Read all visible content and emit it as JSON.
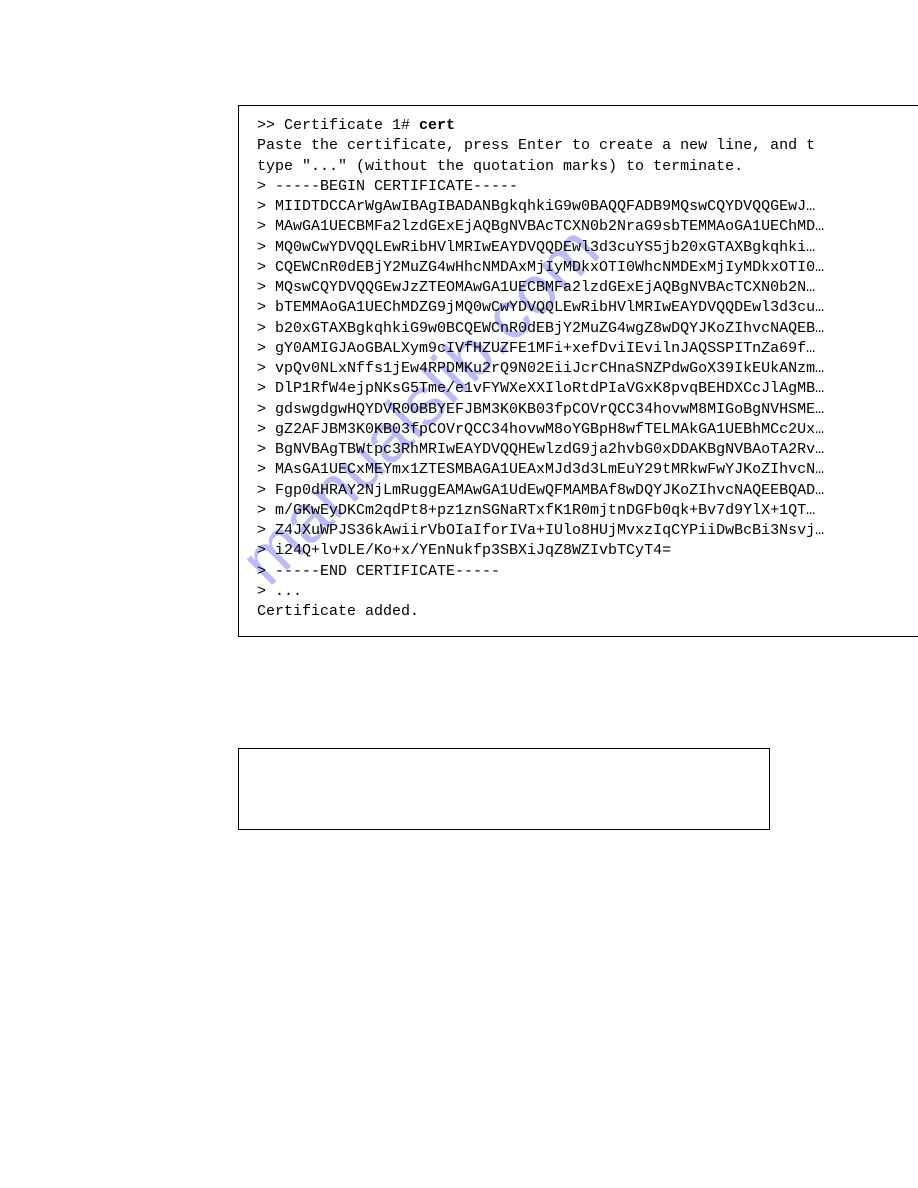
{
  "watermark": "manualslib.com",
  "terminal_output": {
    "prompt_label": ">> Certificate 1# ",
    "command": "cert",
    "instruction_line1": "Paste the certificate, press Enter to create a new line, and t",
    "instruction_line2": "type \"...\" (without the quotation marks) to terminate.",
    "cert_lines": [
      "> -----BEGIN CERTIFICATE-----",
      "> MIIDTDCCArWgAwIBAgIBADANBgkqhkiG9w0BAQQFADB9MQswCQYDVQQGEwJ…",
      "> MAwGA1UECBMFa2lzdGExEjAQBgNVBAcTCXN0b2NraG9sbTEMMAoGA1UEChMD…",
      "> MQ0wCwYDVQQLEwRibHVlMRIwEAYDVQQDEwl3d3cuYS5jb20xGTAXBgkqhki…",
      "> CQEWCnR0dEBjY2MuZG4wHhcNMDAxMjIyMDkxOTI0WhcNMDExMjIyMDkxOTI0…",
      "> MQswCQYDVQQGEwJzZTEOMAwGA1UECBMFa2lzdGExEjAQBgNVBAcTCXN0b2N…",
      "> bTEMMAoGA1UEChMDZG9jMQ0wCwYDVQQLEwRibHVlMRIwEAYDVQQDEwl3d3cu…",
      "> b20xGTAXBgkqhkiG9w0BCQEWCnR0dEBjY2MuZG4wgZ8wDQYJKoZIhvcNAQEB…",
      "> gY0AMIGJAoGBALXym9cIVfHZUZFE1MFi+xefDviIEvilnJAQSSPITnZa69f…",
      "> vpQv0NLxNffs1jEw4RPDMKu2rQ9N02EiiJcrCHnaSNZPdwGoX39IkEUkANzm…",
      "> DlP1RfW4ejpNKsG5Tme/e1vFYWXeXXIloRtdPIaVGxK8pvqBEHDXCcJlAgMB…",
      "> gdswgdgwHQYDVR0OBBYEFJBM3K0KB03fpCOVrQCC34hovwM8MIGoBgNVHSME…",
      "> gZ2AFJBM3K0KB03fpCOVrQCC34hovwM8oYGBpH8wfTELMAkGA1UEBhMCc2Ux…",
      "> BgNVBAgTBWtpc3RhMRIwEAYDVQQHEwlzdG9ja2hvbG0xDDAKBgNVBAoTA2Rv…",
      "> MAsGA1UECxMEYmx1ZTESMBAGA1UEAxMJd3d3LmEuY29tMRkwFwYJKoZIhvcN…",
      "> Fgp0dHRAY2NjLmRuggEAMAwGA1UdEwQFMAMBAf8wDQYJKoZIhvcNAQEEBQAD…",
      "> m/GKwEyDKCm2qdPt8+pz1znSGNaRTxfK1R0mjtnDGFb0qk+Bv7d9YlX+1QT…",
      "> Z4JXuWPJS36kAwiirVbOIaIforIVa+IUlo8HUjMvxzIqCYPiiDwBcBi3Nsvj…",
      "> i24Q+lvDLE/Ko+x/YEnNukfp3SBXiJqZ8WZIvbTCyT4=",
      "> -----END CERTIFICATE-----",
      "> ..."
    ],
    "result": "Certificate added."
  }
}
